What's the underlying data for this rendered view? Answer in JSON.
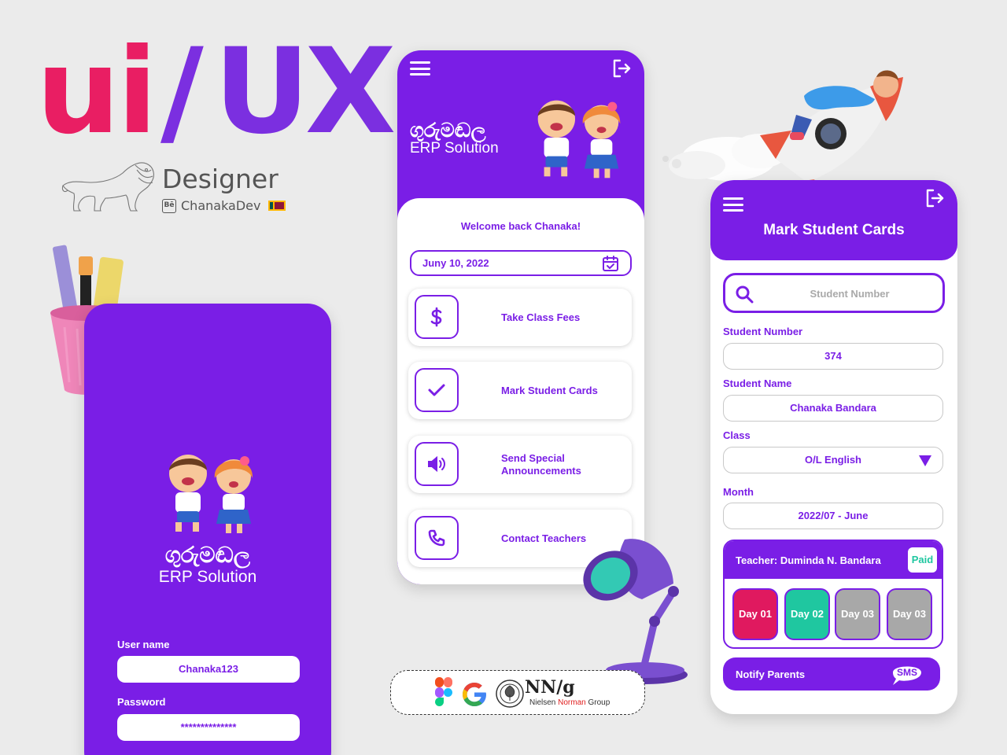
{
  "hero": {
    "title_ui": "ui",
    "title_slash": "/",
    "title_ux": "UX",
    "role": "Designer",
    "author": "ChanakaDev",
    "behance_label": "Bē"
  },
  "brand": {
    "name_si": "ගුරුමඬල",
    "name_en": "ERP Solution"
  },
  "login": {
    "username_label": "User name",
    "username_value": "Chanaka123",
    "password_label": "Password",
    "password_value": "**************"
  },
  "dashboard": {
    "welcome": "Welcome back Chanaka!",
    "date": "Juny 10, 2022",
    "actions": [
      {
        "label": "Take Class Fees",
        "icon": "dollar-icon"
      },
      {
        "label": "Mark Student Cards",
        "icon": "check-icon"
      },
      {
        "label": "Send Special Announcements",
        "icon": "speaker-icon"
      },
      {
        "label": "Contact Teachers",
        "icon": "phone-icon"
      }
    ]
  },
  "mark": {
    "title": "Mark Student Cards",
    "search_placeholder": "Student Number",
    "student_number_label": "Student Number",
    "student_number": "374",
    "student_name_label": "Student Name",
    "student_name": "Chanaka Bandara",
    "class_label": "Class",
    "class_value": "O/L English",
    "month_label": "Month",
    "month_value": "2022/07 - June",
    "teacher": "Teacher: Duminda N. Bandara",
    "paid_badge": "Paid",
    "days": [
      {
        "label": "Day 01",
        "color": "#e0195f"
      },
      {
        "label": "Day 02",
        "color": "#1fc7a0"
      },
      {
        "label": "Day 03",
        "color": "#a8a8a8"
      },
      {
        "label": "Day 03",
        "color": "#a8a8a8"
      }
    ],
    "notify": "Notify Parents",
    "sms_label": "SMS"
  },
  "tools": {
    "nng_mark": "NN/g",
    "nng_name_1": "Nielsen",
    "nng_name_2": "Norman",
    "nng_name_3": "Group"
  },
  "colors": {
    "primary": "#7a1ee6",
    "accent_pink": "#e91e63",
    "paid_green": "#1fc7a0",
    "background": "#ebebeb"
  }
}
